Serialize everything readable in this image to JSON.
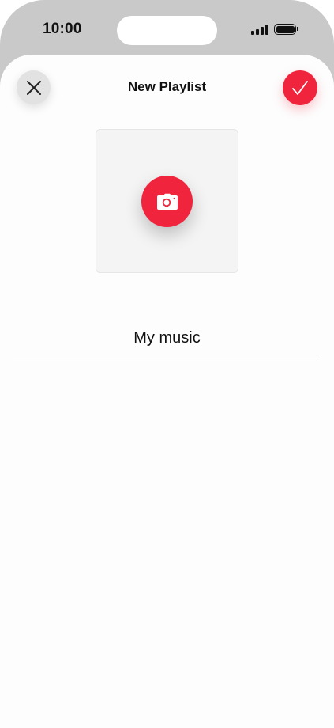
{
  "status_bar": {
    "time": "10:00",
    "signal_icon": "cellular-signal-icon",
    "battery_icon": "battery-icon"
  },
  "header": {
    "title": "New Playlist",
    "close_icon": "close-icon",
    "done_icon": "checkmark-icon"
  },
  "artwork": {
    "camera_icon": "camera-icon"
  },
  "playlist_name": {
    "value": "My music"
  },
  "colors": {
    "accent": "#f0243d",
    "close_button_bg": "#e2e2e2",
    "sheet_bg": "#fdfdfd",
    "outer_bg": "#c9c9c9"
  }
}
